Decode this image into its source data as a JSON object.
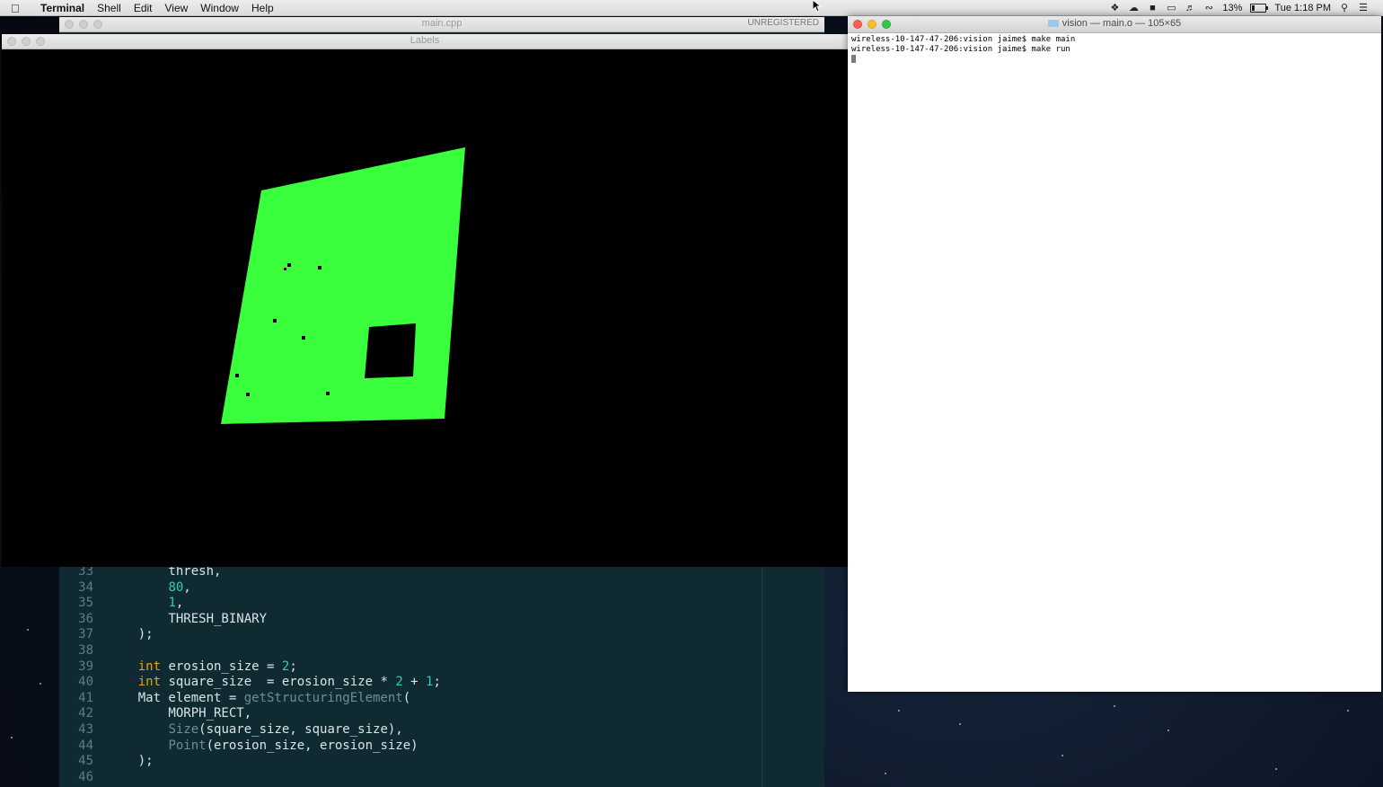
{
  "menubar": {
    "apple": "",
    "app": "Terminal",
    "items": [
      "Shell",
      "Edit",
      "View",
      "Window",
      "Help"
    ],
    "battery": "13%",
    "clock": "Tue 1:18 PM"
  },
  "sublime": {
    "title": "main.cpp",
    "badge": "UNREGISTERED",
    "lines": [
      {
        "n": "33",
        "t": "        thresh,"
      },
      {
        "n": "34",
        "t": "        80,"
      },
      {
        "n": "35",
        "t": "        1,"
      },
      {
        "n": "36",
        "t": "        THRESH_BINARY"
      },
      {
        "n": "37",
        "t": "    );"
      },
      {
        "n": "38",
        "t": ""
      },
      {
        "n": "39",
        "t": "    int erosion_size = 2;"
      },
      {
        "n": "40",
        "t": "    int square_size  = erosion_size * 2 + 1;"
      },
      {
        "n": "41",
        "t": "    Mat element = getStructuringElement("
      },
      {
        "n": "42",
        "t": "        MORPH_RECT,"
      },
      {
        "n": "43",
        "t": "        Size(square_size, square_size),"
      },
      {
        "n": "44",
        "t": "        Point(erosion_size, erosion_size)"
      },
      {
        "n": "45",
        "t": "    );"
      },
      {
        "n": "46",
        "t": ""
      }
    ]
  },
  "labels": {
    "title": "Labels",
    "shape_color": "#39ff3c"
  },
  "terminal": {
    "title": "vision — main.o — 105×65",
    "lines": [
      "wireless-10-147-47-206:vision jaime$ make main",
      "wireless-10-147-47-206:vision jaime$ make run"
    ]
  },
  "colors": {
    "keyword": "#e6a21c",
    "number": "#39c9b8",
    "function": "#6e8e94"
  }
}
